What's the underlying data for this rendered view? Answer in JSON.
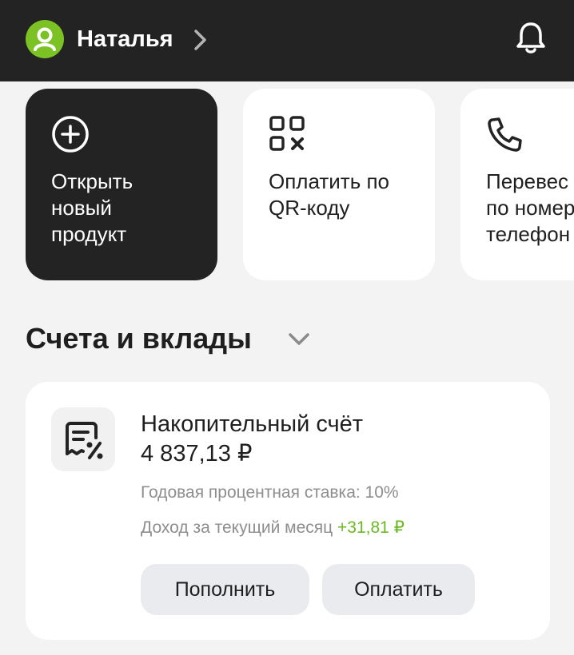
{
  "header": {
    "user_name": "Наталья",
    "icons": {
      "avatar": "user-icon",
      "chevron": "chevron-right-icon",
      "notifications": "bell-icon"
    },
    "colors": {
      "bar": "#232323",
      "avatar": "#7cc224"
    }
  },
  "quick_actions": [
    {
      "label": "Открыть\nновый\nпродукт",
      "icon": "plus-circle-icon",
      "style": "dark"
    },
    {
      "label": "Оплатить по\nQR-коду",
      "icon": "qr-code-icon",
      "style": "light"
    },
    {
      "label": "Перевес\nпо номер\nтелефон",
      "icon": "phone-icon",
      "style": "light"
    }
  ],
  "accounts_section": {
    "title": "Счета и вклады",
    "chevron_icon": "chevron-down-icon"
  },
  "account_card": {
    "icon": "percent-document-icon",
    "title": "Накопительный счёт",
    "balance": "4 837,13 ₽",
    "rate_text": "Годовая процентная ставка: 10%",
    "income_label": "Доход за текущий месяц",
    "income_value": "+31,81 ₽",
    "income_color": "#6ab923",
    "buttons": {
      "top_up": "Пополнить",
      "pay": "Оплатить"
    }
  }
}
